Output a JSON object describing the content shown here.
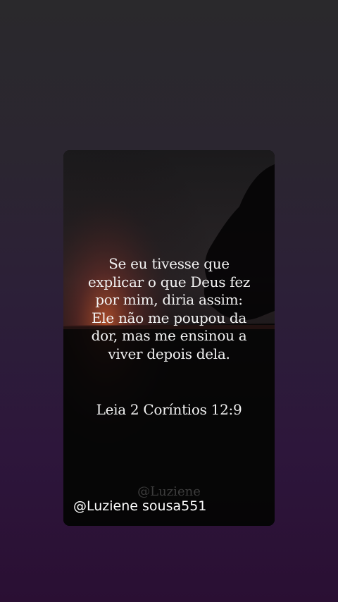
{
  "card": {
    "quote": "Se eu tivesse que\nexplicar o que Deus fez\npor mim, diria assim:\nEle não me poupou da\ndor, mas me ensinou a\nviver depois dela.",
    "reference": "Leia 2 Coríntios 12:9",
    "watermark": "@Luziene"
  },
  "overlay": {
    "handle": "@Luziene sousa551"
  },
  "colors": {
    "background_top": "#2a292c",
    "background_bottom": "#2a0f33",
    "card": "#0c0a0d",
    "text": "#f2f2f2"
  }
}
